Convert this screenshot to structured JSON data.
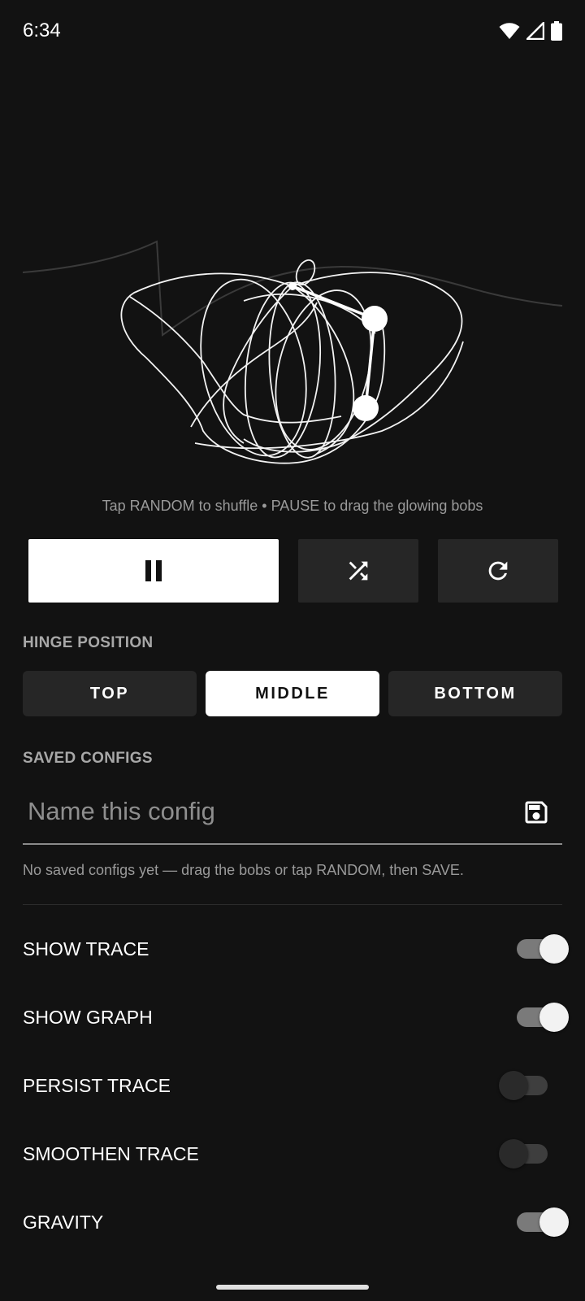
{
  "status_bar": {
    "time": "6:34",
    "icons": [
      "wifi-icon",
      "signal-icon",
      "battery-icon"
    ]
  },
  "hint": "Tap RANDOM to shuffle • PAUSE to drag the glowing bobs",
  "controls": {
    "pause_icon": "pause-icon",
    "shuffle_icon": "shuffle-icon",
    "reset_icon": "refresh-icon"
  },
  "hinge": {
    "label": "HINGE POSITION",
    "options": [
      "TOP",
      "MIDDLE",
      "BOTTOM"
    ],
    "selected": "MIDDLE"
  },
  "saved": {
    "label": "SAVED CONFIGS",
    "placeholder": "Name this config",
    "value": "",
    "empty_message": "No saved configs yet — drag the bobs or tap RANDOM, then SAVE.",
    "save_icon": "save-icon"
  },
  "toggles": [
    {
      "label": "SHOW TRACE",
      "on": true
    },
    {
      "label": "SHOW GRAPH",
      "on": true
    },
    {
      "label": "PERSIST TRACE",
      "on": false
    },
    {
      "label": "SMOOTHEN TRACE",
      "on": false
    },
    {
      "label": "GRAVITY",
      "on": true
    }
  ],
  "colors": {
    "background": "#121212",
    "surface": "#262626",
    "accent": "#ffffff",
    "muted": "#9a9a9a"
  }
}
